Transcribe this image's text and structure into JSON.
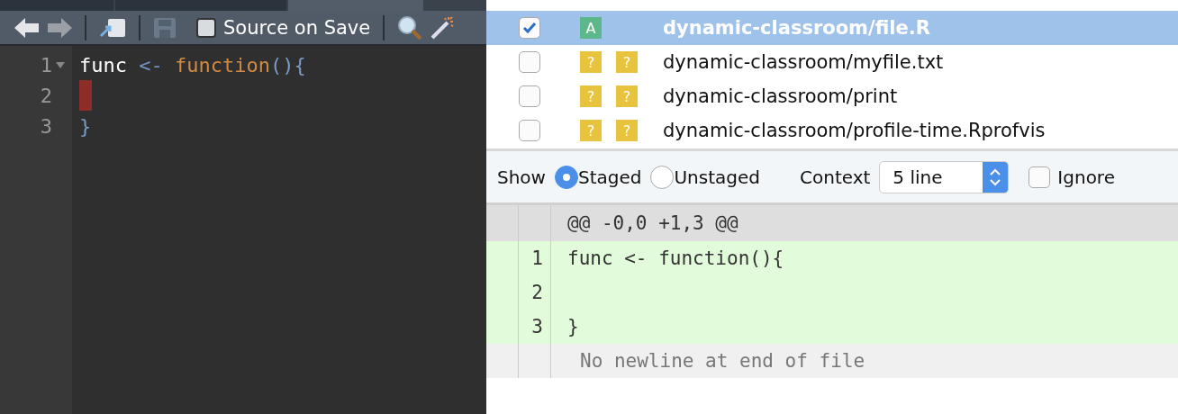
{
  "editor": {
    "toolbar": {
      "source_on_save": {
        "label": "Source on Save",
        "checked": false
      },
      "save_disabled": true
    },
    "lines": [
      {
        "number": "1",
        "foldable": true,
        "cursor": false,
        "tokens": [
          {
            "kind": "identifier",
            "text": "func"
          },
          {
            "kind": "operator",
            "text": " <- "
          },
          {
            "kind": "keyword",
            "text": "function"
          },
          {
            "kind": "paren",
            "text": "()"
          },
          {
            "kind": "paren",
            "text": "{"
          }
        ]
      },
      {
        "number": "2",
        "foldable": false,
        "cursor": true
      },
      {
        "number": "3",
        "foldable": false,
        "cursor": false,
        "tokens": [
          {
            "kind": "paren",
            "text": "}"
          }
        ]
      }
    ]
  },
  "files": [
    {
      "checked": true,
      "selected": true,
      "staged_status": "A",
      "path": "dynamic-classroom/file.R"
    },
    {
      "checked": false,
      "selected": false,
      "staged_status": "?",
      "unstaged_status": "?",
      "path": "dynamic-classroom/myfile.txt"
    },
    {
      "checked": false,
      "selected": false,
      "staged_status": "?",
      "unstaged_status": "?",
      "path": "dynamic-classroom/print"
    },
    {
      "checked": false,
      "selected": false,
      "staged_status": "?",
      "unstaged_status": "?",
      "path": "dynamic-classroom/profile-time.Rprofvis"
    }
  ],
  "diff_options": {
    "show_label": "Show",
    "options": [
      {
        "label": "Staged",
        "selected": true
      },
      {
        "label": "Unstaged",
        "selected": false
      }
    ],
    "context_label": "Context",
    "context_value": "5 line",
    "ignore": {
      "label": "Ignore",
      "checked": false
    }
  },
  "diff": {
    "hunk_header": "@@ -0,0 +1,3 @@",
    "lines": [
      {
        "kind": "added",
        "new": "1",
        "text": "func <- function(){"
      },
      {
        "kind": "added",
        "new": "2"
      },
      {
        "kind": "added",
        "new": "3",
        "text": "}"
      },
      {
        "kind": "note",
        "text": "No newline at end of file"
      }
    ]
  }
}
